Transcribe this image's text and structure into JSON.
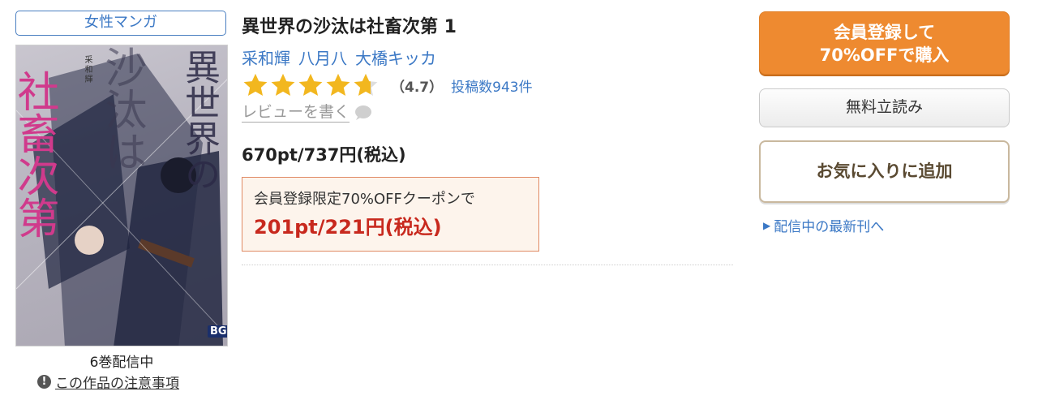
{
  "genre": "女性マンガ",
  "book": {
    "title": "異世界の沙汰は社畜次第 1",
    "authors": [
      "采和輝",
      "八月八",
      "大橋キッカ"
    ],
    "rating_value": "（4.7）",
    "rating_stars": 4.7,
    "review_count": "投稿数943件",
    "write_review": "レビューを書く",
    "price": "670pt/737円(税込)",
    "coupon_label": "会員登録限定70%OFFクーポンで",
    "coupon_price": "201pt/221円(税込)",
    "volumes": "6巻配信中",
    "notice": "この作品の注意事項"
  },
  "cover": {
    "title_left": "社畜次第",
    "title_right": "異世界の",
    "title_middle": "沙汰は",
    "author": "采和輝",
    "label": "BG"
  },
  "actions": {
    "buy_line1": "会員登録して",
    "buy_line2": "70%OFFで購入",
    "trial": "無料立読み",
    "favorite": "お気に入りに追加",
    "latest": "配信中の最新刊へ"
  },
  "colors": {
    "accent_blue": "#3b78c5",
    "buy_orange": "#ee8a30",
    "coupon_red": "#c8291e",
    "star_gold": "#f2b71f"
  },
  "icons": {
    "star": "star-icon",
    "review": "speech-bubble-icon",
    "notice": "exclamation-circle-icon",
    "latest": "triangle-right-icon"
  }
}
